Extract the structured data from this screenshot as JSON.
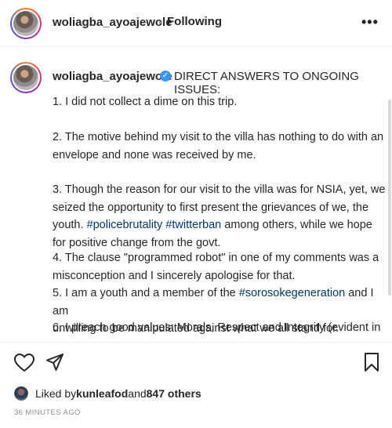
{
  "header": {
    "username": "woliagba_ayoajewole",
    "separator": "•",
    "following_label": "Following",
    "more_label": "•••"
  },
  "caption": {
    "username": "woliagba_ayoajewole",
    "title": "DIRECT ANSWERS TO ONGOING ISSUES:",
    "p1": "1. I did not collect a dime on this trip.",
    "p2_l1": "2. The motive behind my visit to the villa has nothing to do with an",
    "p2_l2": "envelope and none was received by me.",
    "p3_l1": "3. Though the reason for our visit to the villa was for NSIA, yet, we",
    "p3_l2": "seized the opportunity to first present the grievances of we, the",
    "p3_l3a": "youth. ",
    "p3_tag1": "#policebrutality",
    "p3_sp": " ",
    "p3_tag2": "#twitterban",
    "p3_l3b": " among others, while we hope",
    "p3_l4": "for positive change from the govt.",
    "p4_l1": "4. The clause \"programmed robot\" in one of my comments was a",
    "p4_l2": "misconception and I sincerely apologise for that.",
    "p5_l1a": "5. I am a youth and a member of the ",
    "p5_tag": "#sorosokegeneration",
    "p5_l1b": " and I am",
    "p5_l2": "unwilling to be manipulated against what we all stand for.",
    "p6_l1": "6. I preach good values: Morals, Respect and Integrity (evident in"
  },
  "likes": {
    "prefix": "Liked by ",
    "user": "kunleafod",
    "mid": " and ",
    "count": "847 others"
  },
  "timestamp": "36 MINUTES AGO",
  "icons": [
    "heart-icon",
    "share-icon",
    "bookmark-icon",
    "more-icon",
    "verified-badge-icon"
  ]
}
